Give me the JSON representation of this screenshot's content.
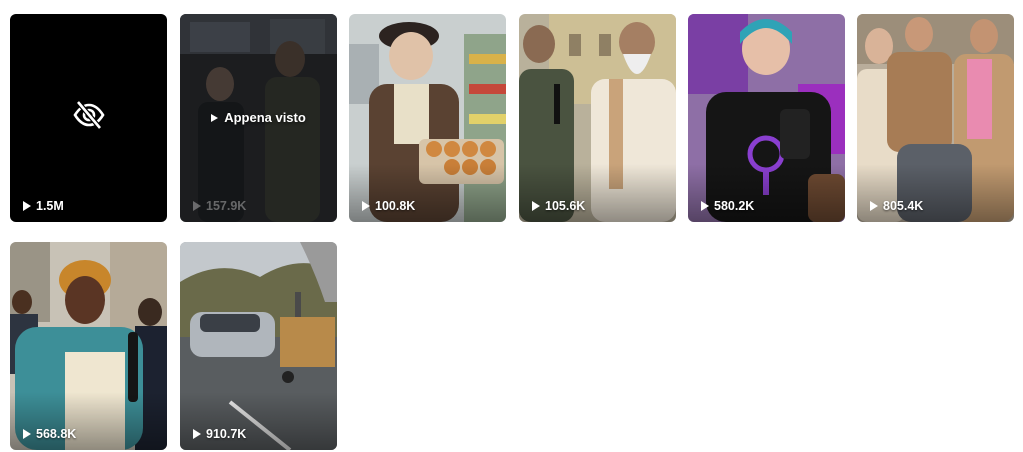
{
  "videos": [
    {
      "views": "1.5M",
      "hidden": true
    },
    {
      "views": "157.9K",
      "overlay": "Appena visto"
    },
    {
      "views": "100.8K"
    },
    {
      "views": "105.6K"
    },
    {
      "views": "580.2K"
    },
    {
      "views": "805.4K"
    },
    {
      "views": "568.8K"
    },
    {
      "views": "910.7K"
    }
  ],
  "icons": {
    "hidden": "eye-slash-icon",
    "play": "play-icon"
  }
}
